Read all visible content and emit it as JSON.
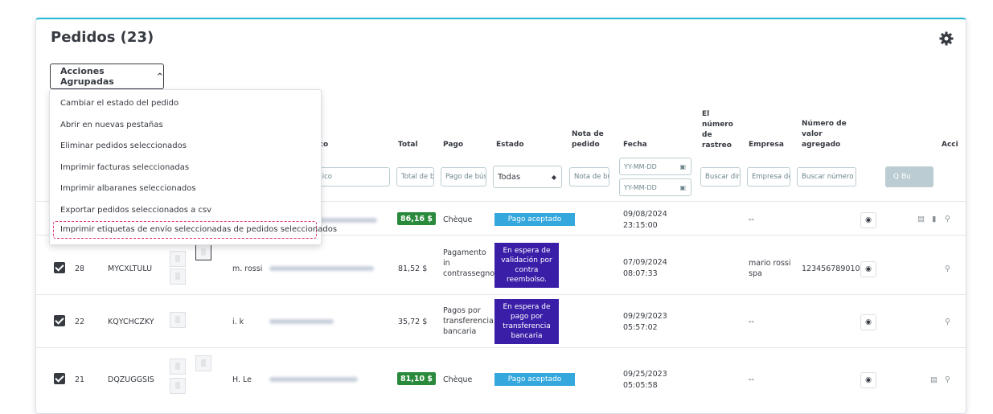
{
  "panel": {
    "title": "Pedidos (23)",
    "settings_icon": "gear-icon"
  },
  "bulk": {
    "button_label": "Acciones Agrupadas",
    "items": [
      "Cambiar el estado del pedido",
      "Abrir en nuevas pestañas",
      "Eliminar pedidos seleccionados",
      "Imprimir facturas seleccionadas",
      "Imprimir albaranes seleccionados",
      "Exportar pedidos seleccionados a csv",
      "Imprimir etiquetas de envío seleccionadas de pedidos seleccionados"
    ]
  },
  "columns": {
    "email_partial": "ónico",
    "total": "Total",
    "payment": "Pago",
    "status": "Estado",
    "note": "Nota de pedido",
    "date": "Fecha",
    "tracking": "El número de rastreo",
    "company": "Empresa",
    "vat": "Número de valor agregado",
    "actions_partial": "Acci"
  },
  "filters": {
    "email": "electrónico",
    "total": "Total de b",
    "payment": "Pago de bús",
    "status": "Todas",
    "note": "Nota de bús",
    "date_from": "YY-MM-DD",
    "date_to": "YY-MM-DD",
    "tracking": "Buscar dire",
    "company": "Empresa de",
    "vat": "Buscar número",
    "search_button": "Q Bu"
  },
  "rows": [
    {
      "total": "86,16 $",
      "payment": "Chèque",
      "status": "Pago aceptado",
      "date": "09/08/2024",
      "time": "23:15:00",
      "tracking": "--"
    },
    {
      "id": "28",
      "reference": "MYCXLTULU",
      "customer": "m. rossi",
      "total": "81,52 $",
      "payment": [
        "Pagamento",
        "in",
        "contrassegno"
      ],
      "status": [
        "En espera de",
        "validación por",
        "contra",
        "reembolso."
      ],
      "date": "07/09/2024",
      "time": "08:07:33",
      "company": [
        "mario rossi",
        "spa"
      ],
      "vat": "123456789010"
    },
    {
      "id": "22",
      "reference": "KQYCHCZKY",
      "customer": "i. k",
      "total": "35,72 $",
      "payment": [
        "Pagos por",
        "transferencia",
        "bancaria"
      ],
      "status": [
        "En espera de",
        "pago por",
        "transferencia",
        "bancaria"
      ],
      "date": "09/29/2023",
      "time": "05:57:02",
      "tracking": "--"
    },
    {
      "id": "21",
      "reference": "DQZUGGSIS",
      "customer": "H. Le",
      "total": "81,10 $",
      "payment": "Chèque",
      "status": "Pago aceptado",
      "date": "09/25/2023",
      "time": "05:05:58",
      "tracking": "--"
    }
  ],
  "colors": {
    "accent": "#25b9d7",
    "paid": "#2a8a3c",
    "status_paid": "#34a7dd",
    "status_waiting": "#3b1ea8",
    "highlight": "#e3367e"
  }
}
